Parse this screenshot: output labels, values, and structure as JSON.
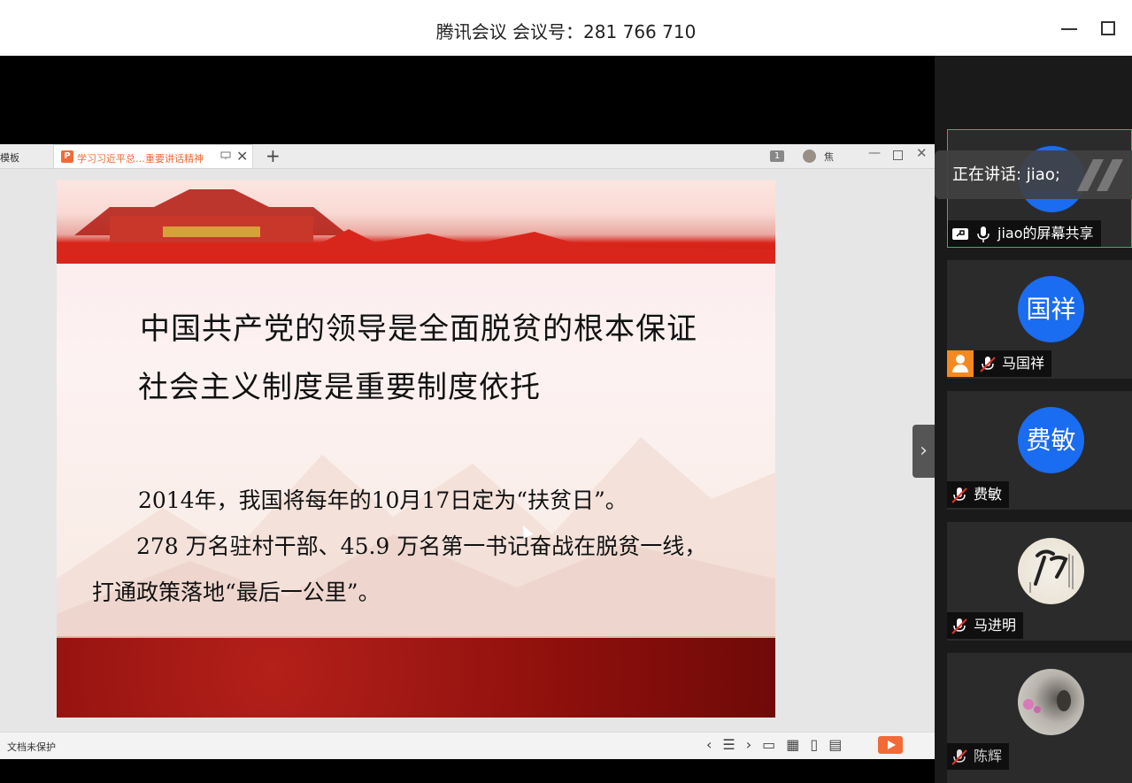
{
  "titlebar": {
    "title": "腾讯会议 会议号：281 766 710"
  },
  "wps": {
    "prev_tab_label": "模板",
    "active_tab_label": "学习习近平总…重要讲话精神",
    "tab_icon_letter": "P",
    "page_badge": "1",
    "user_label": "焦",
    "status_protect": "文档未保护"
  },
  "slide": {
    "heading1": "中国共产党的领导是全面脱贫的根本保证",
    "heading2": "社会主义制度是重要制度依托",
    "body1": "2014年，我国将每年的10月17日定为“扶贫日”。",
    "body2": "278 万名驻村干部、45.9 万名第一书记奋战在脱贫一线，",
    "body3": "打通政策落地“最后一公里”。"
  },
  "panel": {
    "speaking": "正在讲话: jiao;",
    "participants": [
      {
        "name": "jiao的屏幕共享",
        "avatar_text": "",
        "mic": "mic-on"
      },
      {
        "name": "马国祥",
        "avatar_text": "国祥",
        "mic": "mic-off"
      },
      {
        "name": "费敏",
        "avatar_text": "费敏",
        "mic": "mic-off"
      },
      {
        "name": "马进明",
        "avatar_text": "",
        "mic": "mic-off"
      },
      {
        "name": "陈辉",
        "avatar_text": "",
        "mic": "mic-off"
      }
    ]
  },
  "colors": {
    "accent": "#1a6cf0",
    "active_border": "#2bb673",
    "wps_orange": "#f26a36"
  }
}
